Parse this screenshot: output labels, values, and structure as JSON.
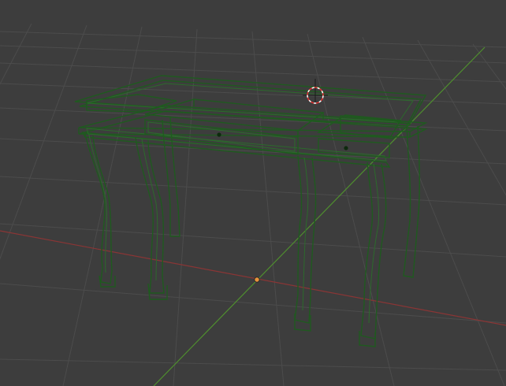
{
  "viewport": {
    "background_color": "#3d3d3d",
    "grid_color": "#4c4c4c",
    "x_axis_color": "#8a3535",
    "y_axis_color": "#4f8f2e",
    "wireframe_color": "#1f5a1f",
    "object_origin_color": "#e8923a",
    "cursor_colors": [
      "#ffffff",
      "#e03030"
    ]
  },
  "icons": {
    "cursor": "3d-cursor-icon",
    "origin": "object-origin-icon"
  },
  "object": {
    "kind": "table-wireframe",
    "selected": false
  }
}
